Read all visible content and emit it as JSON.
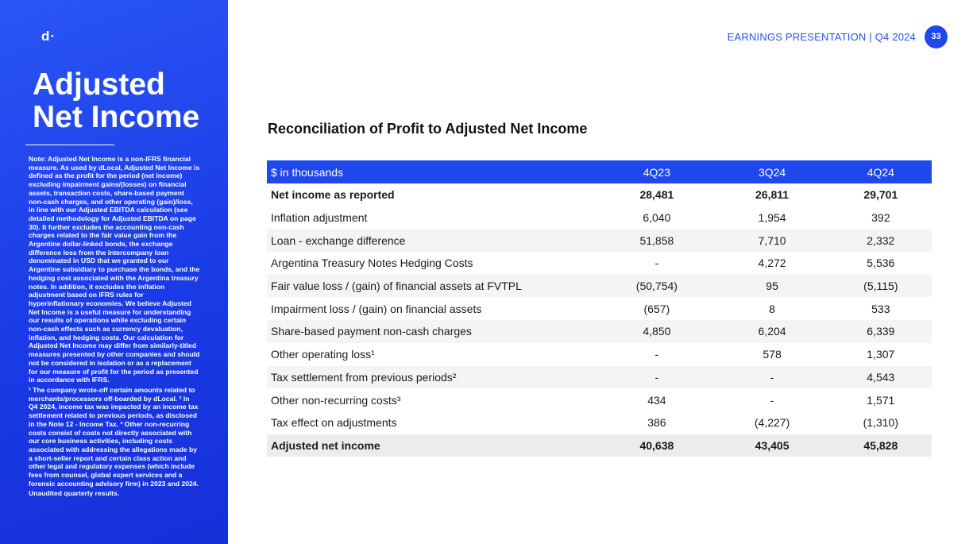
{
  "sidebar": {
    "logo": "d·",
    "title_line1": "Adjusted",
    "title_line2": "Net Income",
    "note": "Note: Adjusted Net Income is a non-IFRS financial measure. As used by dLocal, Adjusted Net Income is defined as the profit for the period (net income) excluding impairment gains/(losses) on financial assets, transaction costs, share-based payment non-cash charges, and other operating (gain)/loss, in line with our Adjusted EBITDA calculation (see detailed methodology for Adjusted EBITDA on page 30). It further excludes the accounting non-cash charges related to the fair value gain from the Argentine dollar-linked bonds, the exchange difference loss from the intercompany loan denominated in USD that we granted to our Argentine subsidiary to purchase the bonds, and the hedging cost associated with the Argentina treasury notes. In addition, it excludes the inflation adjustment based on IFRS rules for hyperinflationary economies. We believe Adjusted Net Income is a useful measure for understanding our results of operations while excluding certain non-cash effects such as currency devaluation, inflation, and hedging costs. Our calculation for Adjusted Net Income may differ from similarly-titled measures presented by other companies and should not be considered in isolation or as a replacement for our measure of profit for the period as presented in accordance with IFRS.",
    "footnotes": "¹ The company wrote-off certain amounts related to merchants/processors off-boarded by dLocal. ² In Q4 2024, income tax was impacted by an income tax settlement related to previous periods, as disclosed in the Note 12 - Income Tax. ³ Other non-recurring costs consist of costs not directly associated with our core business activities, including costs associated with addressing the allegations made by a short-seller report and certain class action and other legal and regulatory expenses (which include fees from counsel, global expert services and a forensic accounting advisory firm) in 2023 and 2024.",
    "unaudited": "Unaudited quarterly results."
  },
  "header": {
    "text": "EARNINGS PRESENTATION | Q4 2024",
    "page_number": "33"
  },
  "section_title": "Reconciliation of Profit to Adjusted Net Income",
  "table": {
    "columns": [
      "$ in thousands",
      "4Q23",
      "3Q24",
      "4Q24"
    ],
    "rows": [
      {
        "label": "Net income as reported",
        "values": [
          "28,481",
          "26,811",
          "29,701"
        ]
      },
      {
        "label": "Inflation adjustment",
        "values": [
          "6,040",
          "1,954",
          "392"
        ]
      },
      {
        "label": "Loan - exchange difference",
        "values": [
          "51,858",
          "7,710",
          "2,332"
        ]
      },
      {
        "label": "Argentina Treasury Notes Hedging Costs",
        "values": [
          "-",
          "4,272",
          "5,536"
        ]
      },
      {
        "label": "Fair value loss / (gain) of financial assets at FVTPL",
        "values": [
          "(50,754)",
          "95",
          "(5,115)"
        ]
      },
      {
        "label": "Impairment loss / (gain) on financial assets",
        "values": [
          "(657)",
          "8",
          "533"
        ]
      },
      {
        "label": "Share-based payment non-cash charges",
        "values": [
          "4,850",
          "6,204",
          "6,339"
        ]
      },
      {
        "label": "Other operating loss¹",
        "values": [
          "-",
          "578",
          "1,307"
        ]
      },
      {
        "label": "Tax settlement from previous periods²",
        "values": [
          "-",
          "-",
          "4,543"
        ]
      },
      {
        "label": "Other non-recurring costs³",
        "values": [
          "434",
          "-",
          "1,571"
        ]
      },
      {
        "label": "Tax effect on adjustments",
        "values": [
          "386",
          "(4,227)",
          "(1,310)"
        ]
      },
      {
        "label": "Adjusted net income",
        "values": [
          "40,638",
          "43,405",
          "45,828"
        ]
      }
    ]
  }
}
